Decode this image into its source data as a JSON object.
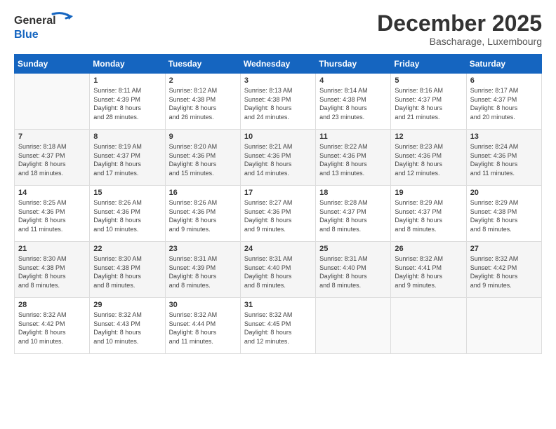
{
  "header": {
    "logo_general": "General",
    "logo_blue": "Blue",
    "month_title": "December 2025",
    "subtitle": "Bascharage, Luxembourg"
  },
  "days_of_week": [
    "Sunday",
    "Monday",
    "Tuesday",
    "Wednesday",
    "Thursday",
    "Friday",
    "Saturday"
  ],
  "weeks": [
    [
      {
        "day": "",
        "content": ""
      },
      {
        "day": "1",
        "content": "Sunrise: 8:11 AM\nSunset: 4:39 PM\nDaylight: 8 hours\nand 28 minutes."
      },
      {
        "day": "2",
        "content": "Sunrise: 8:12 AM\nSunset: 4:38 PM\nDaylight: 8 hours\nand 26 minutes."
      },
      {
        "day": "3",
        "content": "Sunrise: 8:13 AM\nSunset: 4:38 PM\nDaylight: 8 hours\nand 24 minutes."
      },
      {
        "day": "4",
        "content": "Sunrise: 8:14 AM\nSunset: 4:38 PM\nDaylight: 8 hours\nand 23 minutes."
      },
      {
        "day": "5",
        "content": "Sunrise: 8:16 AM\nSunset: 4:37 PM\nDaylight: 8 hours\nand 21 minutes."
      },
      {
        "day": "6",
        "content": "Sunrise: 8:17 AM\nSunset: 4:37 PM\nDaylight: 8 hours\nand 20 minutes."
      }
    ],
    [
      {
        "day": "7",
        "content": "Sunrise: 8:18 AM\nSunset: 4:37 PM\nDaylight: 8 hours\nand 18 minutes."
      },
      {
        "day": "8",
        "content": "Sunrise: 8:19 AM\nSunset: 4:37 PM\nDaylight: 8 hours\nand 17 minutes."
      },
      {
        "day": "9",
        "content": "Sunrise: 8:20 AM\nSunset: 4:36 PM\nDaylight: 8 hours\nand 15 minutes."
      },
      {
        "day": "10",
        "content": "Sunrise: 8:21 AM\nSunset: 4:36 PM\nDaylight: 8 hours\nand 14 minutes."
      },
      {
        "day": "11",
        "content": "Sunrise: 8:22 AM\nSunset: 4:36 PM\nDaylight: 8 hours\nand 13 minutes."
      },
      {
        "day": "12",
        "content": "Sunrise: 8:23 AM\nSunset: 4:36 PM\nDaylight: 8 hours\nand 12 minutes."
      },
      {
        "day": "13",
        "content": "Sunrise: 8:24 AM\nSunset: 4:36 PM\nDaylight: 8 hours\nand 11 minutes."
      }
    ],
    [
      {
        "day": "14",
        "content": "Sunrise: 8:25 AM\nSunset: 4:36 PM\nDaylight: 8 hours\nand 11 minutes."
      },
      {
        "day": "15",
        "content": "Sunrise: 8:26 AM\nSunset: 4:36 PM\nDaylight: 8 hours\nand 10 minutes."
      },
      {
        "day": "16",
        "content": "Sunrise: 8:26 AM\nSunset: 4:36 PM\nDaylight: 8 hours\nand 9 minutes."
      },
      {
        "day": "17",
        "content": "Sunrise: 8:27 AM\nSunset: 4:36 PM\nDaylight: 8 hours\nand 9 minutes."
      },
      {
        "day": "18",
        "content": "Sunrise: 8:28 AM\nSunset: 4:37 PM\nDaylight: 8 hours\nand 8 minutes."
      },
      {
        "day": "19",
        "content": "Sunrise: 8:29 AM\nSunset: 4:37 PM\nDaylight: 8 hours\nand 8 minutes."
      },
      {
        "day": "20",
        "content": "Sunrise: 8:29 AM\nSunset: 4:38 PM\nDaylight: 8 hours\nand 8 minutes."
      }
    ],
    [
      {
        "day": "21",
        "content": "Sunrise: 8:30 AM\nSunset: 4:38 PM\nDaylight: 8 hours\nand 8 minutes."
      },
      {
        "day": "22",
        "content": "Sunrise: 8:30 AM\nSunset: 4:38 PM\nDaylight: 8 hours\nand 8 minutes."
      },
      {
        "day": "23",
        "content": "Sunrise: 8:31 AM\nSunset: 4:39 PM\nDaylight: 8 hours\nand 8 minutes."
      },
      {
        "day": "24",
        "content": "Sunrise: 8:31 AM\nSunset: 4:40 PM\nDaylight: 8 hours\nand 8 minutes."
      },
      {
        "day": "25",
        "content": "Sunrise: 8:31 AM\nSunset: 4:40 PM\nDaylight: 8 hours\nand 8 minutes."
      },
      {
        "day": "26",
        "content": "Sunrise: 8:32 AM\nSunset: 4:41 PM\nDaylight: 8 hours\nand 9 minutes."
      },
      {
        "day": "27",
        "content": "Sunrise: 8:32 AM\nSunset: 4:42 PM\nDaylight: 8 hours\nand 9 minutes."
      }
    ],
    [
      {
        "day": "28",
        "content": "Sunrise: 8:32 AM\nSunset: 4:42 PM\nDaylight: 8 hours\nand 10 minutes."
      },
      {
        "day": "29",
        "content": "Sunrise: 8:32 AM\nSunset: 4:43 PM\nDaylight: 8 hours\nand 10 minutes."
      },
      {
        "day": "30",
        "content": "Sunrise: 8:32 AM\nSunset: 4:44 PM\nDaylight: 8 hours\nand 11 minutes."
      },
      {
        "day": "31",
        "content": "Sunrise: 8:32 AM\nSunset: 4:45 PM\nDaylight: 8 hours\nand 12 minutes."
      },
      {
        "day": "",
        "content": ""
      },
      {
        "day": "",
        "content": ""
      },
      {
        "day": "",
        "content": ""
      }
    ]
  ]
}
